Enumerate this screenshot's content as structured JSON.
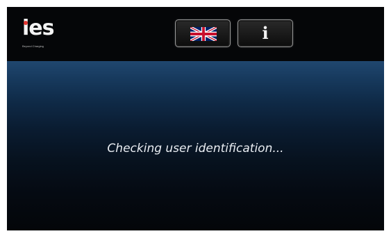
{
  "header": {
    "logo": {
      "text": "ies",
      "tagline": "Beyond Charging"
    },
    "language_button": {
      "icon": "uk-flag-icon"
    },
    "info_button": {
      "glyph": "i",
      "icon": "info-icon"
    }
  },
  "main": {
    "status_text": "Checking user identification..."
  },
  "colors": {
    "background": "#050608",
    "gradient_top": "#20476f",
    "text": "#e9edf2",
    "logo_accent": "#e3342f"
  }
}
